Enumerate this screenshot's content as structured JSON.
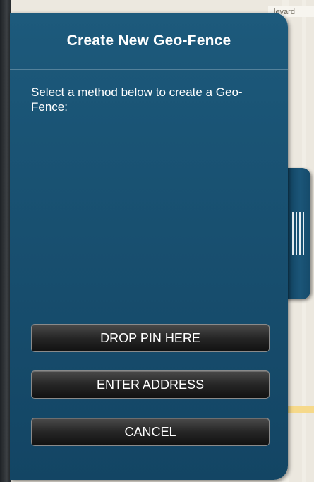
{
  "map": {
    "street_label": "levard"
  },
  "panel": {
    "title": "Create New Geo-Fence",
    "description": "Select a method below to create a Geo-Fence:",
    "buttons": {
      "drop_pin": "DROP PIN HERE",
      "enter_address": "ENTER ADDRESS",
      "cancel": "CANCEL"
    }
  },
  "side_tab": {
    "icon": "grip-handle-icon"
  },
  "colors": {
    "panel_top": "#1d5a7c",
    "panel_bottom": "#134564",
    "button_dark": "#111111",
    "text": "#ffffff"
  }
}
